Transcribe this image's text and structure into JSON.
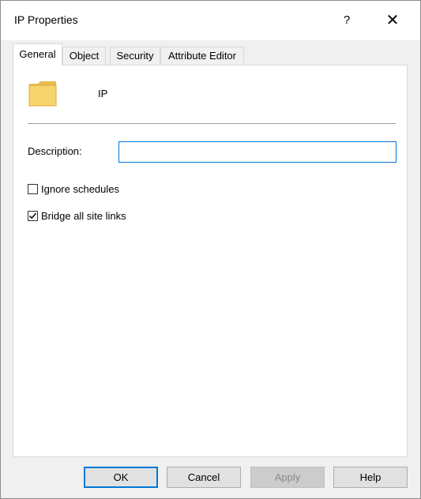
{
  "window": {
    "title": "IP Properties",
    "help_glyph": "?",
    "close_glyph": "✕"
  },
  "tabs": [
    {
      "label": "General",
      "active": true
    },
    {
      "label": "Object",
      "active": false
    },
    {
      "label": "Security",
      "active": false
    },
    {
      "label": "Attribute Editor",
      "active": false
    }
  ],
  "general": {
    "object_icon": "folder-icon",
    "object_name": "IP",
    "description_label": "Description:",
    "description_value": "",
    "ignore_schedules": {
      "label": "Ignore schedules",
      "checked": false
    },
    "bridge_all_site_links": {
      "label": "Bridge all site links",
      "checked": true
    }
  },
  "buttons": {
    "ok": "OK",
    "cancel": "Cancel",
    "apply": "Apply",
    "help": "Help"
  },
  "colors": {
    "accent": "#0078d7",
    "folder": "#f6d46c",
    "button_face": "#e1e1e1"
  }
}
